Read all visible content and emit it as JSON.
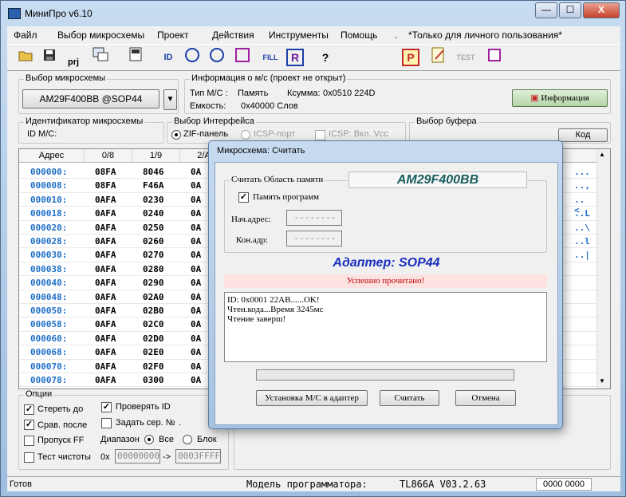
{
  "window": {
    "title": "МиниПро v6.10",
    "minimize_glyph": "—",
    "maximize_glyph": "☐",
    "close_glyph": "X"
  },
  "menu": [
    "Файл",
    "Выбор микросхемы",
    "Проект",
    "Действия",
    "Инструменты",
    "Помощь",
    ".",
    "*Только для личного пользования*"
  ],
  "toolbar": {
    "icons": [
      "open-icon",
      "save-icon",
      "project-icon",
      "load-file-icon",
      "save-file-icon",
      "read-id-icon",
      "read-icon",
      "program-icon",
      "verify-icon",
      "fill-icon",
      "read-chip-icon",
      "help-icon",
      "protect-icon",
      "edit-icon",
      "test-icon",
      "chip-test-icon"
    ],
    "labels": {
      "prj": "prj",
      "fill": "FILL",
      "r": "R",
      "help": "?",
      "p": "P",
      "test": "TEST"
    }
  },
  "chip_select": {
    "label": "Выбор микросхемы",
    "value": "AM29F400BB  @SOP44",
    "dropdown_glyph": "▼"
  },
  "chip_info": {
    "label": "Информация о м/с (проект не открыт)",
    "type_label": "Тип М/С :",
    "type_value": "Память",
    "checksum_label": "Ксумма:",
    "checksum_value": "0x0510 224D",
    "capacity_label": "Емкость:",
    "capacity_value": "0x40000 Слов",
    "info_button": "Информация"
  },
  "chip_id": {
    "label": "Идентификатор микросхемы",
    "id_label": "ID M/C:"
  },
  "interface": {
    "label": "Выбор Интерфейса",
    "zif": "ZIF-панель",
    "icsp": "ICSP-порт",
    "icsp_vcc": "ICSP: Вкл. Vcc"
  },
  "buffer": {
    "label": "Выбор буфера",
    "code_button": "Код"
  },
  "grid": {
    "headers": [
      "Адрес",
      "0/8",
      "1/9",
      "2/A"
    ],
    "rows": [
      [
        "000000:",
        "08FA",
        "8046",
        "0A"
      ],
      [
        "000008:",
        "08FA",
        "F46A",
        "0A"
      ],
      [
        "000010:",
        "0AFA",
        "0230",
        "0A"
      ],
      [
        "000018:",
        "0AFA",
        "0240",
        "0A"
      ],
      [
        "000020:",
        "0AFA",
        "0250",
        "0A"
      ],
      [
        "000028:",
        "0AFA",
        "0260",
        "0A"
      ],
      [
        "000030:",
        "0AFA",
        "0270",
        "0A"
      ],
      [
        "000038:",
        "0AFA",
        "0280",
        "0A"
      ],
      [
        "000040:",
        "0AFA",
        "0290",
        "0A"
      ],
      [
        "000048:",
        "0AFA",
        "02A0",
        "0A"
      ],
      [
        "000050:",
        "0AFA",
        "02B0",
        "0A"
      ],
      [
        "000058:",
        "0AFA",
        "02C0",
        "0A"
      ],
      [
        "000060:",
        "0AFA",
        "02D0",
        "0A"
      ],
      [
        "000068:",
        "0AFA",
        "02E0",
        "0A"
      ],
      [
        "000070:",
        "0AFA",
        "02F0",
        "0A"
      ],
      [
        "000078:",
        "0AFA",
        "0300",
        "0A"
      ]
    ],
    "ascii_column": [
      "...",
      "..,",
      "..<",
      "..L",
      "..\\",
      "..l",
      "..|",
      "",
      "",
      "",
      "",
      "",
      "",
      "",
      "",
      ""
    ]
  },
  "options": {
    "label": "Опции",
    "erase": "Стереть до",
    "verify_id": "Проверять ID",
    "compare_after": "Срав. после",
    "set_serial": "Задать сер. №",
    "serial_dot": ".",
    "skip_ff": "Пропуск FF",
    "range_label": "Диапазон",
    "range_all": "Все",
    "range_block": "Блок",
    "blank_test": "Тест чистоты",
    "hex_prefix": "0x",
    "range_from": "00000000",
    "range_arrow": "->",
    "range_to": "0003FFFF"
  },
  "status": {
    "ready": "Готов",
    "model_label": "Модель программатора:",
    "model_value": "TL866A V03.2.63",
    "counter": "0000 0000"
  },
  "dialog": {
    "title": "Микросхема: Считать",
    "read_area_label": "Считать Область памяти",
    "chip_name": "AM29F400BB",
    "program_memory": "Память программ",
    "start_addr_label": "Нач.адрес:",
    "start_addr_value": "--------",
    "end_addr_label": "Кон.адр:",
    "end_addr_value": "--------",
    "adapter": "Адаптер: SOP44",
    "success": "Успешно прочитано!",
    "log": [
      "ID: 0x0001 22AB......OK!",
      "Чтен.кода...Время 3245мс",
      "Чтение заверш!"
    ],
    "progress": 0,
    "btn_adapter": "Установка М/С в адаптер",
    "btn_read": "Считать",
    "btn_cancel": "Отмена"
  }
}
